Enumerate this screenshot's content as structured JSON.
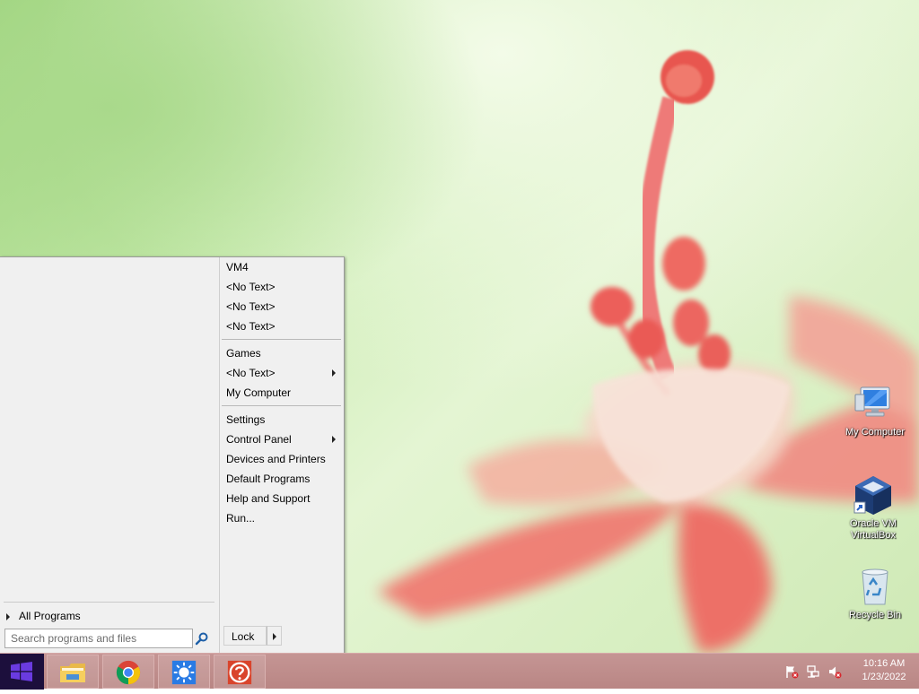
{
  "desktop": {
    "icons": [
      {
        "label": "My Computer",
        "icon": "computer-icon"
      },
      {
        "label": "Oracle VM VirtualBox",
        "icon": "virtualbox-icon"
      },
      {
        "label": "Recycle Bin",
        "icon": "recycle-bin-icon"
      }
    ]
  },
  "start_menu": {
    "all_programs": "All Programs",
    "search_placeholder": "Search programs and files",
    "search_value": "",
    "right_items": [
      {
        "label": "VM4",
        "submenu": false
      },
      {
        "label": "<No Text>",
        "submenu": false
      },
      {
        "label": "<No Text>",
        "submenu": false
      },
      {
        "label": "<No Text>",
        "submenu": false
      },
      {
        "label": "Games",
        "submenu": false
      },
      {
        "label": "<No Text>",
        "submenu": true
      },
      {
        "label": "My Computer",
        "submenu": false
      },
      {
        "label": "Settings",
        "submenu": false
      },
      {
        "label": "Control Panel",
        "submenu": true
      },
      {
        "label": "Devices and Printers",
        "submenu": false
      },
      {
        "label": "Default Programs",
        "submenu": false
      },
      {
        "label": "Help and Support",
        "submenu": false
      },
      {
        "label": "Run...",
        "submenu": false
      }
    ],
    "lock_label": "Lock"
  },
  "taskbar": {
    "pinned": [
      {
        "name": "file-explorer-icon"
      },
      {
        "name": "chrome-icon"
      },
      {
        "name": "brightness-app-icon"
      },
      {
        "name": "help-app-icon"
      }
    ],
    "tray_icons": [
      "action-center-flag-icon",
      "network-icon",
      "volume-muted-icon"
    ],
    "clock": {
      "time": "10:16 AM",
      "date": "1/23/2022"
    }
  },
  "colors": {
    "taskbar": "#bd8b89",
    "start_button": "#1c0f3c",
    "menu_bg": "#f0f0f0",
    "windows_logo": "#6a3be0"
  }
}
